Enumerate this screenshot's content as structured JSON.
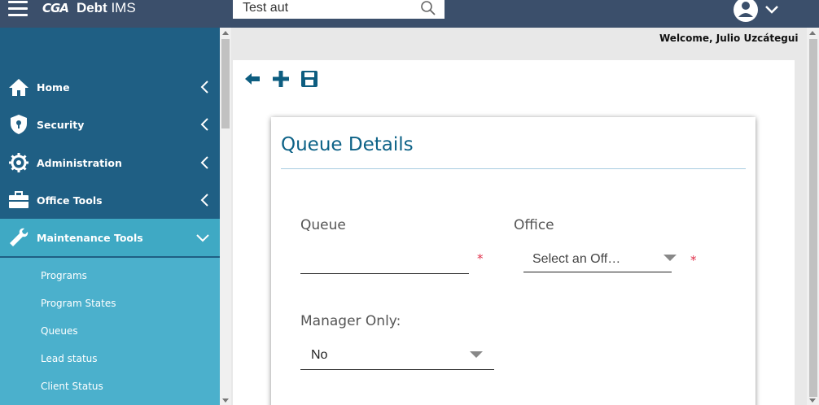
{
  "app": {
    "logo_mark": "CGA",
    "name_bold": "Debt",
    "name_rest": " IMS"
  },
  "search": {
    "value": "Test aut"
  },
  "welcome": "Welcome, Julio Uzcátegui",
  "sidebar": {
    "items": [
      {
        "label": "Home",
        "icon": "home-icon"
      },
      {
        "label": "Security",
        "icon": "shield-icon"
      },
      {
        "label": "Administration",
        "icon": "gear-icon"
      },
      {
        "label": "Office Tools",
        "icon": "briefcase-icon"
      },
      {
        "label": "Maintenance Tools",
        "icon": "wrench-icon"
      }
    ],
    "submenu": [
      "Programs",
      "Program States",
      "Queues",
      "Lead status",
      "Client Status"
    ]
  },
  "card": {
    "title": "Queue Details",
    "queue_label": "Queue",
    "queue_value": "",
    "office_label": "Office",
    "office_placeholder": "Select an Off…",
    "manager_label": "Manager Only:",
    "manager_value": "No",
    "required_mark": "*"
  },
  "colors": {
    "topbar": "#3b4f6b",
    "sidebar": "#1f5f84",
    "active": "#3fa9c4",
    "accent": "#0d6287",
    "required": "#e0304a"
  }
}
